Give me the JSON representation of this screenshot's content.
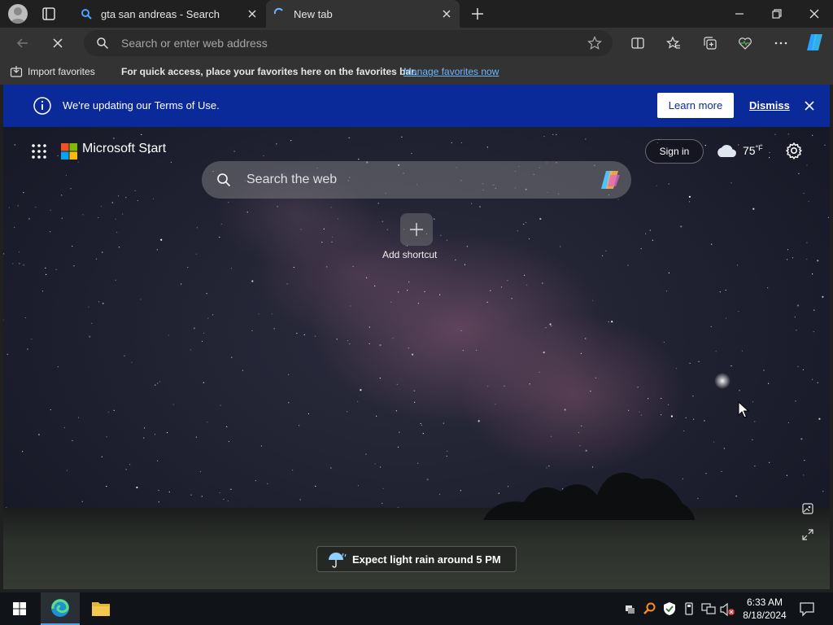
{
  "tabs": [
    {
      "title": "gta san andreas - Search",
      "active": false
    },
    {
      "title": "New tab",
      "active": true
    }
  ],
  "address_bar": {
    "placeholder": "Search or enter web address"
  },
  "favorites_bar": {
    "import_label": "Import favorites",
    "hint": "For quick access, place your favorites here on the favorites bar.",
    "manage_link": "Manage favorites now"
  },
  "banner": {
    "message": "We're updating our Terms of Use.",
    "learn_more": "Learn more",
    "dismiss": "Dismiss"
  },
  "new_tab_page": {
    "brand": "Microsoft Start",
    "sign_in": "Sign in",
    "temperature": "75",
    "temperature_unit": "°F",
    "search_placeholder": "Search the web",
    "add_shortcut": "Add shortcut",
    "weather_alert": "Expect light rain around 5 PM"
  },
  "taskbar": {
    "time": "6:33 AM",
    "date": "8/18/2024"
  },
  "colors": {
    "banner_bg": "#0b2a9a",
    "chrome_dark": "#202020",
    "toolbar": "#333333",
    "link": "#6cb6ff"
  }
}
